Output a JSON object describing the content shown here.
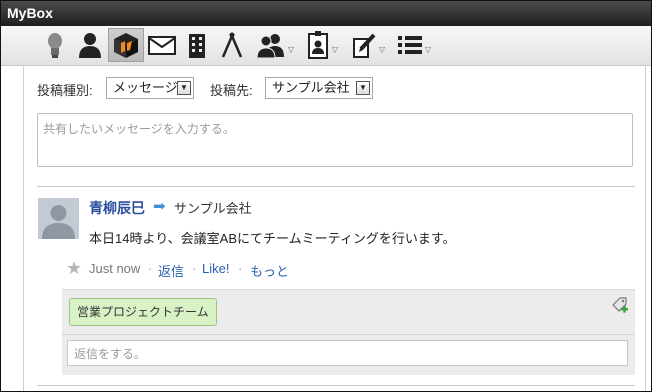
{
  "window": {
    "title": "MyBox"
  },
  "toolbar": {
    "icons": [
      "lightbulb-icon",
      "person-icon",
      "box-icon",
      "mail-icon",
      "building-icon",
      "compass-icon",
      "users-icon",
      "badge-icon",
      "pencil-icon",
      "list-icon"
    ],
    "active_index": 2
  },
  "form": {
    "type_label": "投稿種別:",
    "type_value": "メッセージ",
    "dest_label": "投稿先:",
    "dest_value": "サンプル会社",
    "message_placeholder": "共有したいメッセージを入力する。"
  },
  "post": {
    "author": "青柳辰巳",
    "target": "サンプル会社",
    "message": "本日14時より、会議室ABにてチームミーティングを行います。",
    "time": "Just now",
    "reply_link": "返信",
    "like_link": "Like!",
    "more_link": "もっと",
    "separator": "·",
    "tag": "営業プロジェクトチーム",
    "reply_placeholder": "返信をする。"
  },
  "colors": {
    "link": "#2a5fb0",
    "author": "#2a4e9c",
    "tag_bg": "#d8f2c6",
    "arrow": "#3f8fd6"
  }
}
